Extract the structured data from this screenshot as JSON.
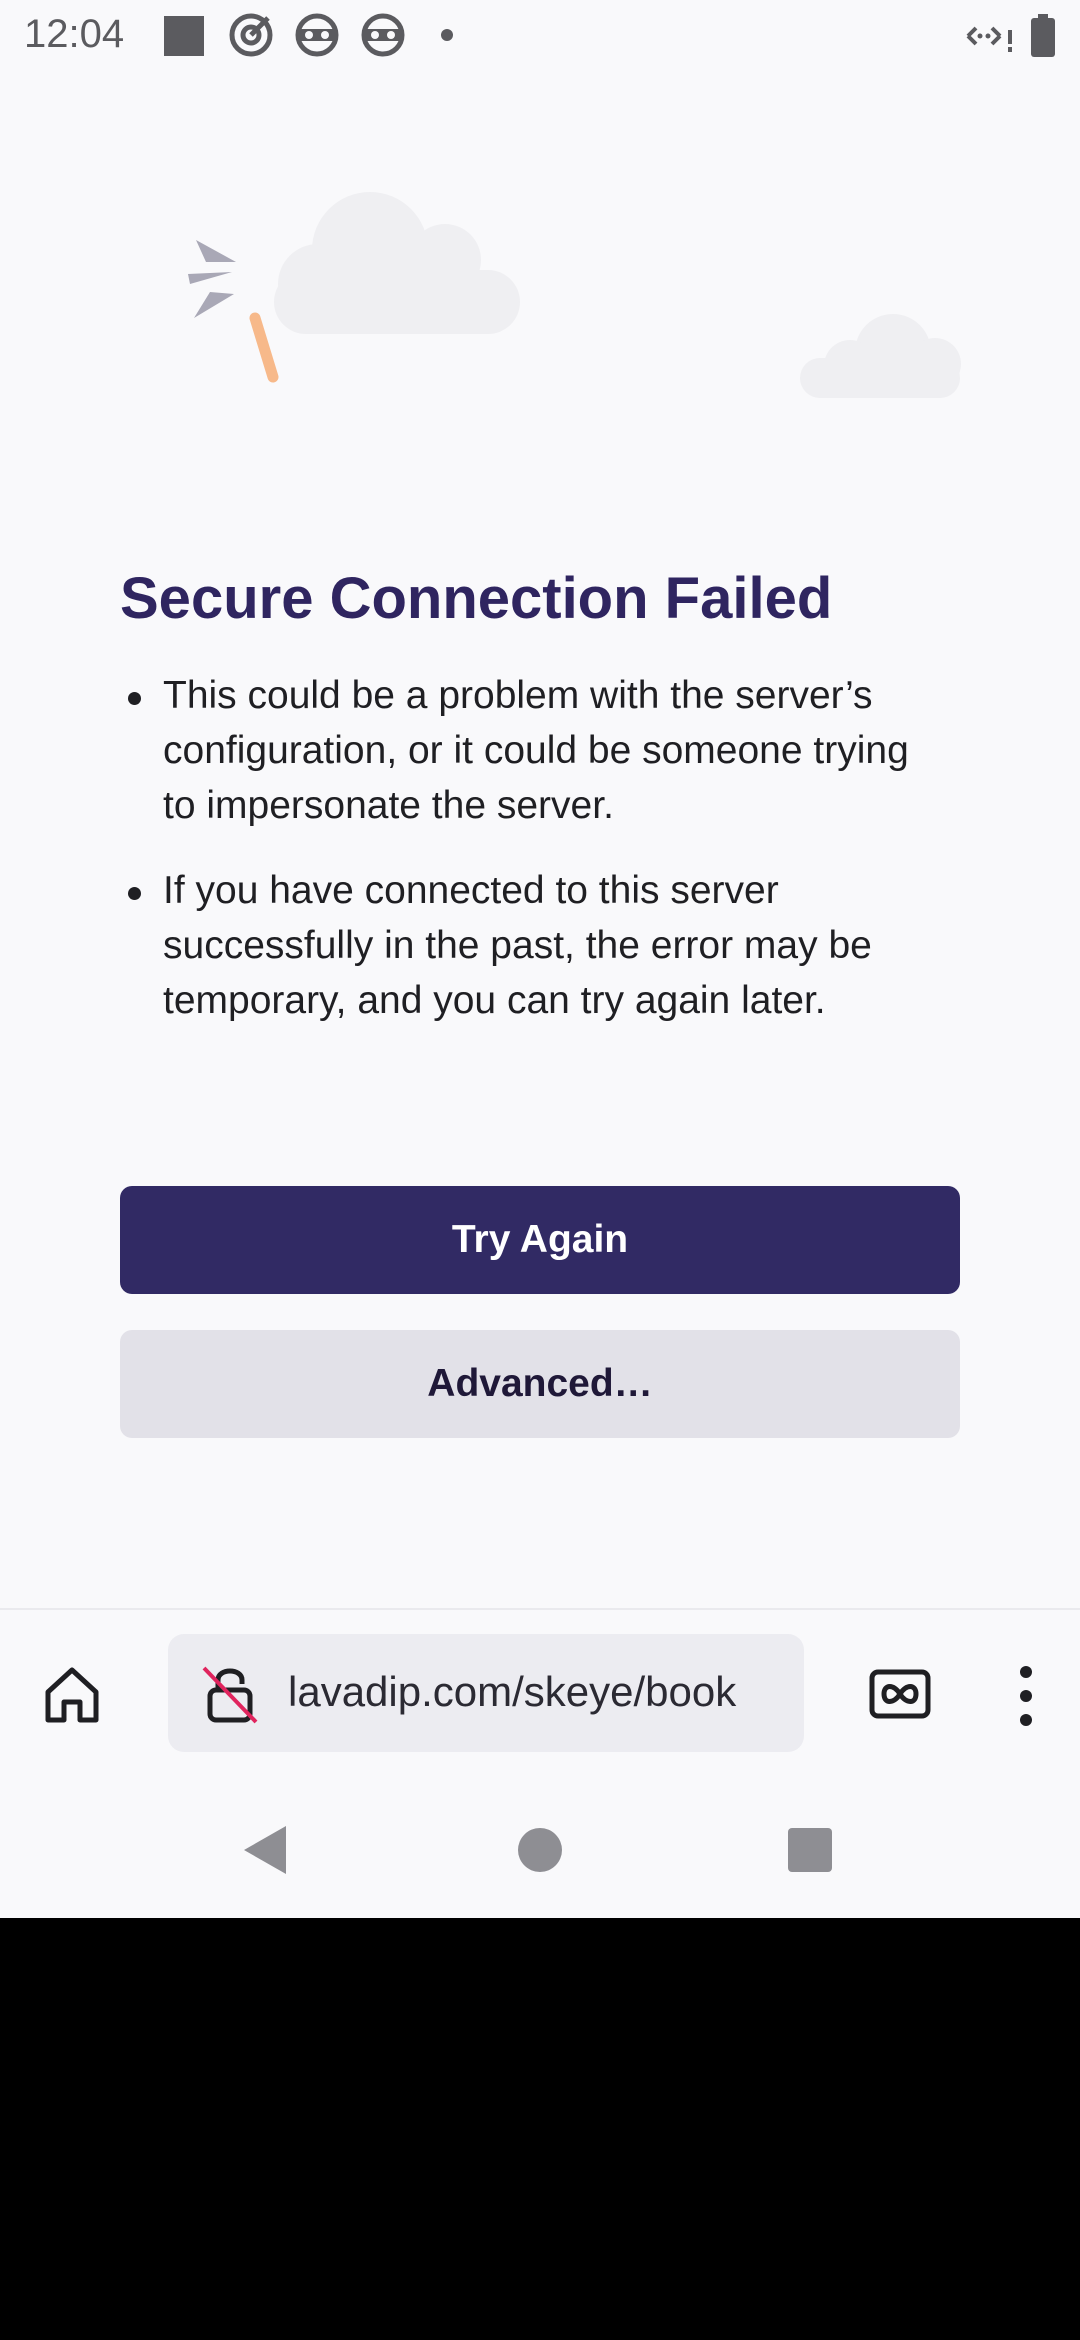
{
  "status_bar": {
    "time": "12:04",
    "left_icons": [
      "square-notification-icon",
      "target-icon",
      "vpn-icon",
      "vpn-icon",
      "dot-icon"
    ],
    "right_icons": [
      "data-transfer-icon",
      "battery-icon"
    ]
  },
  "error": {
    "title": "Secure Connection Failed",
    "bullets": [
      "This could be a problem with the server’s configuration, or it could be someone trying to impersonate the server.",
      "If you have connected to this server successfully in the past, the error may be temporary, and you can try again later."
    ],
    "try_again_label": "Try Again",
    "advanced_label": "Advanced…"
  },
  "toolbar": {
    "url": "lavadip.com/skeye/book",
    "icons": [
      "home-icon",
      "broken-lock-icon",
      "private-mask-icon",
      "more-vertical-icon"
    ]
  },
  "navigation": {
    "icons": [
      "back-icon",
      "home-circle-icon",
      "recents-icon"
    ]
  },
  "colors": {
    "title": "#2f2560",
    "primary_button": "#312a64",
    "secondary_button": "#e2e1e8",
    "background": "#f9f9fb",
    "broken_lock_slash": "#e0245e"
  }
}
